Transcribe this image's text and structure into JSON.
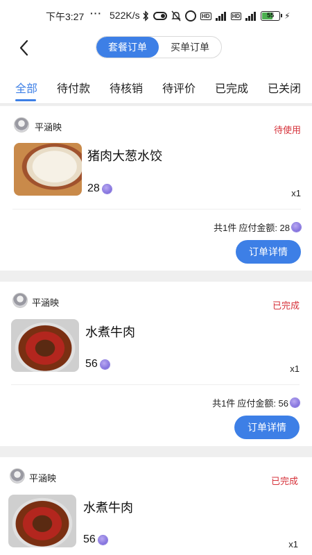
{
  "status_bar": {
    "time": "下午3:27",
    "dots": "···",
    "speed": "522K/s",
    "battery": "55"
  },
  "header": {
    "segments": [
      "套餐订单",
      "买单订单"
    ],
    "active_segment": 0
  },
  "tabs": [
    "全部",
    "待付款",
    "待核销",
    "待评价",
    "已完成",
    "已关闭"
  ],
  "active_tab": 0,
  "orders": [
    {
      "shop": "平涵映",
      "status": "待使用",
      "title": "猪肉大葱水饺",
      "price": "28",
      "qty": "x1",
      "summary_count": "共1件",
      "summary_label": "应付金额: 28",
      "button": "订单详情"
    },
    {
      "shop": "平涵映",
      "status": "已完成",
      "title": "水煮牛肉",
      "price": "56",
      "qty": "x1",
      "summary_count": "共1件",
      "summary_label": "应付金额: 56",
      "button": "订单详情"
    },
    {
      "shop": "平涵映",
      "status": "已完成",
      "title": "水煮牛肉",
      "price": "56",
      "qty": "x1"
    }
  ],
  "colors": {
    "accent": "#3d7fe6",
    "status_red": "#d6323a"
  }
}
